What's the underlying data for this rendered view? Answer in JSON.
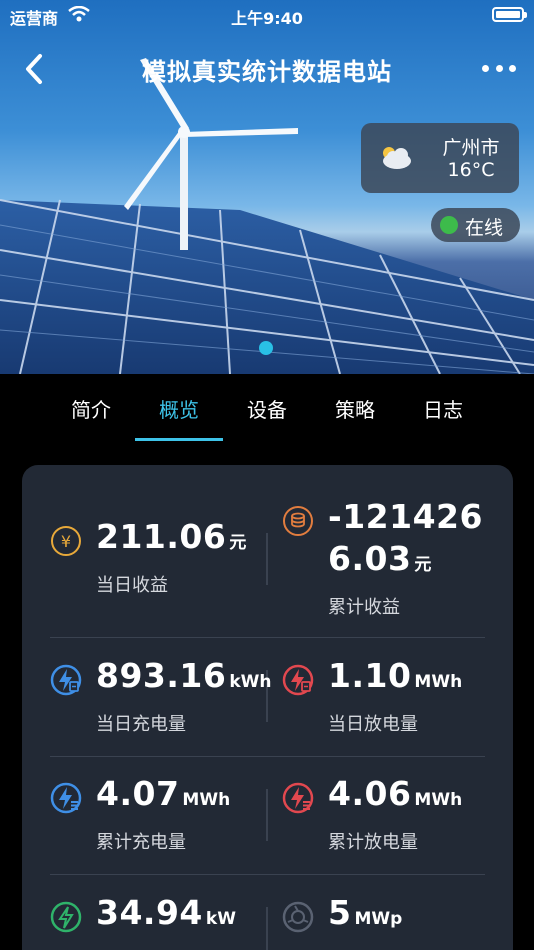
{
  "status_bar": {
    "carrier": "运营商",
    "time": "上午9:40"
  },
  "header": {
    "title": "模拟真实统计数据电站"
  },
  "weather": {
    "city": "广州市",
    "temp": "16°C",
    "icon": "partly-cloudy-icon"
  },
  "status_badge": {
    "label": "在线",
    "color": "#3dbb4b"
  },
  "tabs": [
    {
      "label": "简介",
      "active": false
    },
    {
      "label": "概览",
      "active": true
    },
    {
      "label": "设备",
      "active": false
    },
    {
      "label": "策略",
      "active": false
    },
    {
      "label": "日志",
      "active": false
    }
  ],
  "accent_color": "#3ec3e8",
  "stats": {
    "daily_revenue": {
      "value": "211.06",
      "unit": "元",
      "label": "当日收益",
      "icon": "yuan-icon"
    },
    "total_revenue": {
      "value_line1": "-121426",
      "value_line2": "6.03",
      "unit": "元",
      "label": "累计收益",
      "icon": "coins-icon"
    },
    "daily_charge": {
      "value": "893.16",
      "unit": "kWh",
      "label": "当日充电量",
      "icon": "charge-icon"
    },
    "daily_discharge": {
      "value": "1.10",
      "unit": "MWh",
      "label": "当日放电量",
      "icon": "discharge-icon"
    },
    "total_charge": {
      "value": "4.07",
      "unit": "MWh",
      "label": "累计充电量",
      "icon": "total-charge-icon"
    },
    "total_discharge": {
      "value": "4.06",
      "unit": "MWh",
      "label": "累计放电量",
      "icon": "total-discharge-icon"
    },
    "power": {
      "value": "34.94",
      "unit": "kW",
      "icon": "power-icon"
    },
    "capacity": {
      "value": "5",
      "unit": "MWp",
      "icon": "capacity-icon"
    }
  }
}
